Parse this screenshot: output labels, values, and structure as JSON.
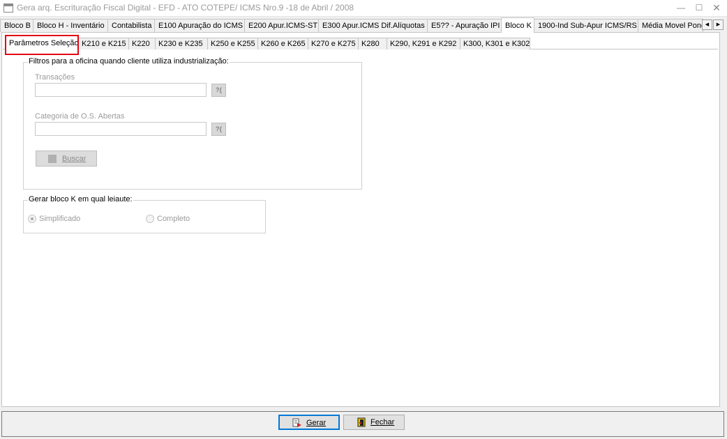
{
  "window": {
    "title": "Gera arq. Escrituração Fiscal Digital - EFD - ATO COTEPE/ ICMS Nro.9 -18 de Abril / 2008",
    "minimize": "—",
    "maximize": "☐",
    "close": "✕"
  },
  "main_tabs": [
    {
      "label": "Bloco B"
    },
    {
      "label": "Bloco H - Inventário"
    },
    {
      "label": "Contabilista"
    },
    {
      "label": "E100 Apuração do ICMS"
    },
    {
      "label": "E200 Apur.ICMS-ST"
    },
    {
      "label": "E300 Apur.ICMS Dif.Alíquotas"
    },
    {
      "label": "E5?? - Apuração IPI"
    },
    {
      "label": "Bloco K"
    },
    {
      "label": "1900-Ind Sub-Apur ICMS/RS"
    },
    {
      "label": "Média Movel Ponde"
    }
  ],
  "tab_scroll": {
    "left": "◀",
    "right": "▶"
  },
  "sub_tabs": [
    {
      "label": "Parâmetros Seleção"
    },
    {
      "label": "K210 e K215"
    },
    {
      "label": "K220"
    },
    {
      "label": "K230 e K235"
    },
    {
      "label": "K250 e K255"
    },
    {
      "label": "K260 e K265"
    },
    {
      "label": "K270 e K275"
    },
    {
      "label": "K280"
    },
    {
      "label": "K290, K291 e K292"
    },
    {
      "label": "K300, K301 e K302"
    }
  ],
  "filters": {
    "title": "Filtros para a oficina quando cliente utiliza industrialização:",
    "transacoes_label": "Transações",
    "transacoes_value": "",
    "categoria_label": "Categoria de O.S. Abertas",
    "categoria_value": "",
    "lookup_glyph": "?{",
    "search_button": "Buscar"
  },
  "layout_group": {
    "title": "Gerar bloco K em qual leiaute:",
    "options": [
      {
        "label": "Simplificado",
        "checked": true
      },
      {
        "label": "Completo",
        "checked": false
      }
    ]
  },
  "footer": {
    "generate_button": "Gerar",
    "close_button": "Fechar"
  }
}
